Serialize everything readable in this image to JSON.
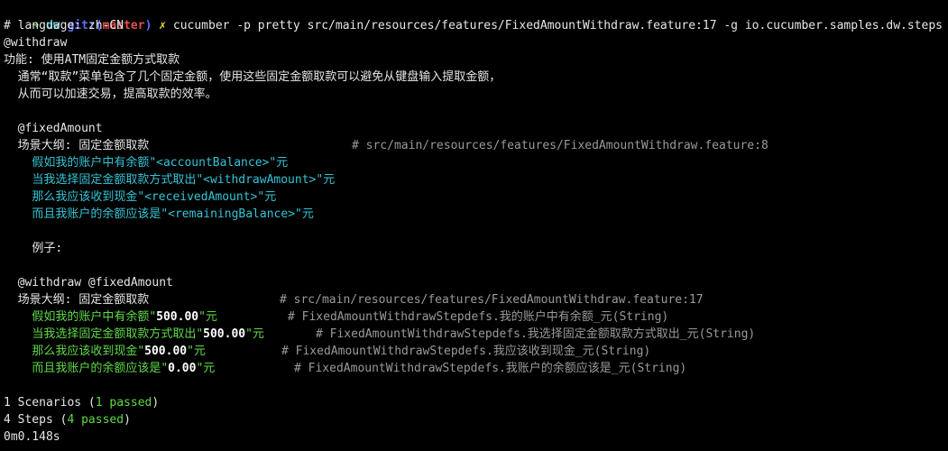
{
  "prompt": {
    "arrow": "➜",
    "dir": "dw",
    "git_prefix": "git:(",
    "branch": "master",
    "git_suffix": ")",
    "dirty_mark": "✗",
    "command": "cucumber -p pretty src/main/resources/features/FixedAmountWithdraw.feature:17 -g io.cucumber.samples.dw.steps"
  },
  "header": {
    "language": "# language: zh-CN",
    "tag": "@withdraw",
    "feature": "功能: 使用ATM固定金额方式取款",
    "desc1": "通常“取款”菜单包含了几个固定金额，使用这些固定金额取款可以避免从键盘输入提取金额，",
    "desc2": "从而可以加速交易，提高取款的效率。"
  },
  "outline": {
    "tag": "@fixedAmount",
    "title": "场景大纲: 固定金额取款",
    "comment": "# src/main/resources/features/FixedAmountWithdraw.feature:8",
    "steps": [
      {
        "prefix": "假如我的账户中有余额\"",
        "param": "<accountBalance>",
        "suffix": "\"元"
      },
      {
        "prefix": "当我选择固定金额取款方式取出\"",
        "param": "<withdrawAmount>",
        "suffix": "\"元"
      },
      {
        "prefix": "那么我应该收到现金\"",
        "param": "<receivedAmount>",
        "suffix": "\"元"
      },
      {
        "prefix": "而且我账户的余额应该是\"",
        "param": "<remainingBalance>",
        "suffix": "\"元"
      }
    ],
    "examples": "例子:"
  },
  "scenario": {
    "tags": "@withdraw @fixedAmount",
    "title": "场景大纲: 固定金额取款",
    "comment": "# src/main/resources/features/FixedAmountWithdraw.feature:17",
    "steps": [
      {
        "prefix": "假如我的账户中有余额\"",
        "value": "500.00",
        "suffix": "\"元",
        "comment": "# FixedAmountWithdrawStepdefs.我的账户中有余额_元(String)"
      },
      {
        "prefix": "当我选择固定金额取款方式取出\"",
        "value": "500.00",
        "suffix": "\"元",
        "comment": "# FixedAmountWithdrawStepdefs.我选择固定金额取款方式取出_元(String)"
      },
      {
        "prefix": "那么我应该收到现金\"",
        "value": "500.00",
        "suffix": "\"元",
        "comment": "# FixedAmountWithdrawStepdefs.我应该收到现金_元(String)"
      },
      {
        "prefix": "而且我账户的余额应该是\"",
        "value": "0.00",
        "suffix": "\"元",
        "comment": "# FixedAmountWithdrawStepdefs.我账户的余额应该是_元(String)"
      }
    ]
  },
  "summary": {
    "scenarios_prefix": "1 Scenarios (",
    "scenarios_passed": "1 passed",
    "scenarios_suffix": ")",
    "steps_prefix": "4 Steps (",
    "steps_passed": "4 passed",
    "steps_suffix": ")",
    "duration": "0m0.148s"
  },
  "colors": {
    "background": "#000000",
    "text": "#e6e6e6",
    "passed_green": "#5fd948",
    "outline_cyan": "#35c4d6",
    "comment_grey": "#9a9a9a",
    "git_blue": "#5c6cf2",
    "branch_red": "#e84c4c",
    "dirty_yellow": "#e9e03c"
  }
}
